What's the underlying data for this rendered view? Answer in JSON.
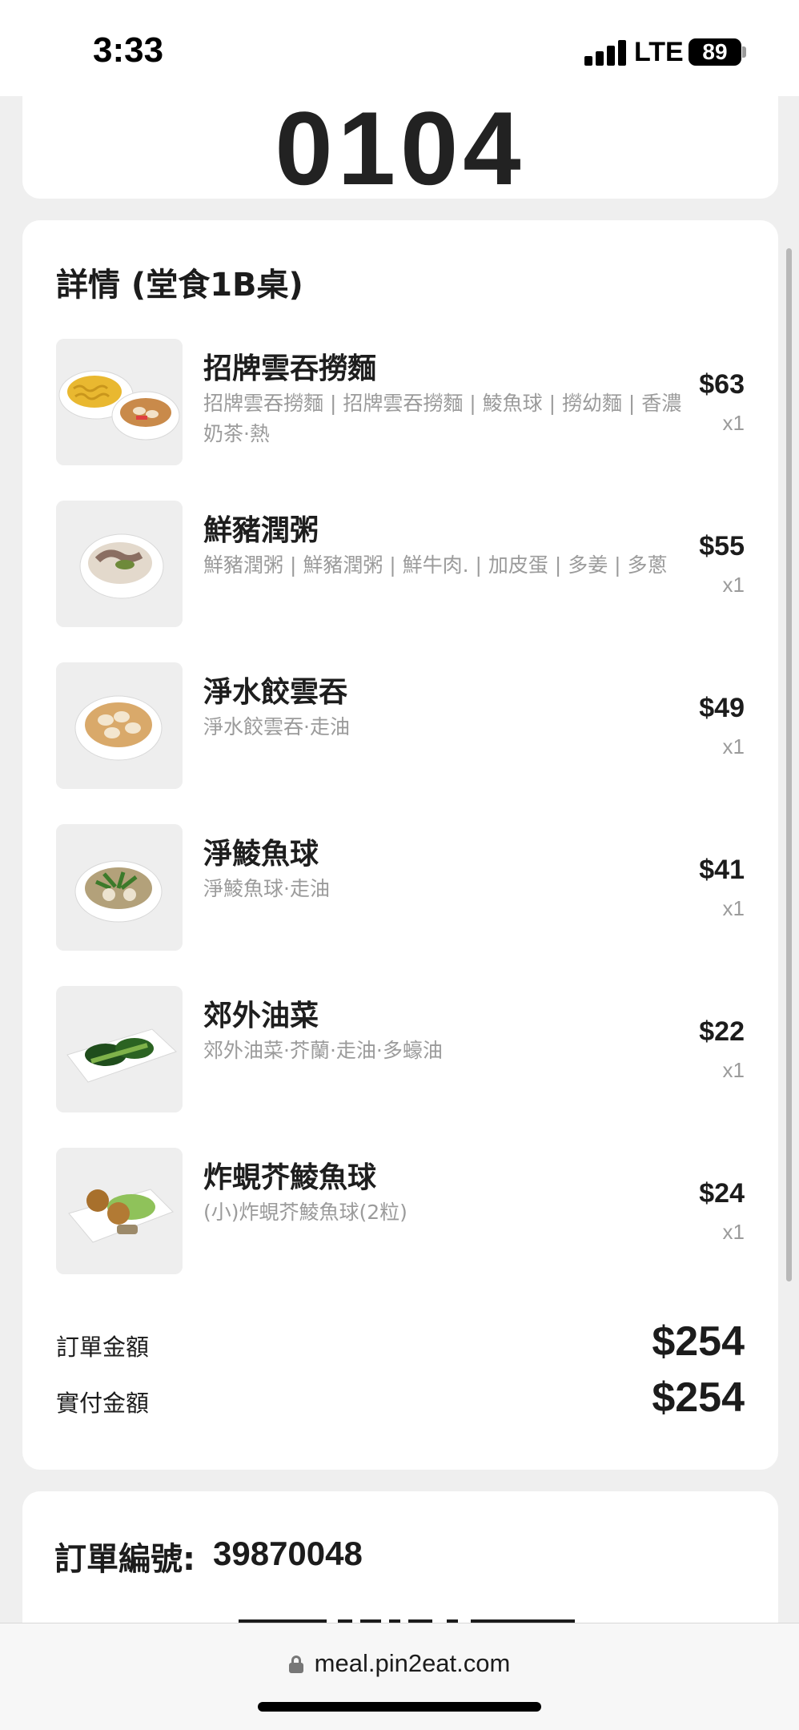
{
  "status_bar": {
    "time": "3:33",
    "network": "LTE",
    "battery": "89"
  },
  "top_card": {
    "queue_number": "0104"
  },
  "detail": {
    "title": "詳情 (堂食1B桌)",
    "items": [
      {
        "name": "招牌雲吞撈麵",
        "desc": "招牌雲吞撈麵 | 招牌雲吞撈麵 | 鯪魚球 | 撈幼麵 | 香濃奶茶·熱",
        "price": "$63",
        "qty": "x1",
        "image": "wonton-noodle-photo"
      },
      {
        "name": "鮮豬潤粥",
        "desc": "鮮豬潤粥 | 鮮豬潤粥 | 鮮牛肉. | 加皮蛋 | 多姜 | 多蔥",
        "price": "$55",
        "qty": "x1",
        "image": "pork-liver-congee-photo"
      },
      {
        "name": "淨水餃雲吞",
        "desc": "淨水餃雲吞·走油",
        "price": "$49",
        "qty": "x1",
        "image": "dumpling-wonton-photo"
      },
      {
        "name": "淨鯪魚球",
        "desc": "淨鯪魚球·走油",
        "price": "$41",
        "qty": "x1",
        "image": "fish-ball-soup-photo"
      },
      {
        "name": "郊外油菜",
        "desc": "郊外油菜·芥蘭·走油·多蠔油",
        "price": "$22",
        "qty": "x1",
        "image": "greens-photo"
      },
      {
        "name": "炸蜆芥鯪魚球",
        "desc": "(小)炸蜆芥鯪魚球(2粒)",
        "price": "$24",
        "qty": "x1",
        "image": "fried-fish-ball-photo"
      }
    ],
    "order_amount_label": "訂單金額",
    "order_amount": "$254",
    "paid_amount_label": "實付金額",
    "paid_amount": "$254"
  },
  "order_card": {
    "label": "訂單編號:",
    "number": "39870048"
  },
  "browser": {
    "url": "meal.pin2eat.com"
  },
  "colors": {
    "page_bg": "#efefef",
    "card_bg": "#ffffff",
    "text_primary": "#1c1c1c",
    "text_secondary": "#9b9b9b"
  }
}
